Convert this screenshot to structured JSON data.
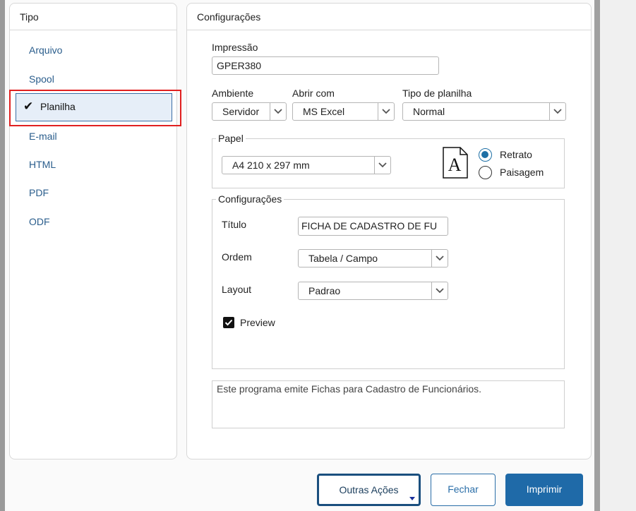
{
  "tipo": {
    "title": "Tipo",
    "items": [
      {
        "label": "Arquivo"
      },
      {
        "label": "Spool"
      },
      {
        "label": "Planilha",
        "selected": true
      },
      {
        "label": "E-mail"
      },
      {
        "label": "HTML"
      },
      {
        "label": "PDF"
      },
      {
        "label": "ODF"
      }
    ],
    "selected_check": "✔"
  },
  "config": {
    "title": "Configurações",
    "impressao": {
      "label": "Impressão",
      "value": "GPER380"
    },
    "ambiente": {
      "label": "Ambiente",
      "value": "Servidor"
    },
    "abrir_com": {
      "label": "Abrir com",
      "value": "MS Excel"
    },
    "tipo_planilha": {
      "label": "Tipo de planilha",
      "value": "Normal"
    },
    "papel": {
      "legend": "Papel",
      "size": "A4 210 x 297 mm",
      "orientation_icon_letter": "A",
      "retrato": "Retrato",
      "paisagem": "Paisagem",
      "selected": "Retrato"
    },
    "settings": {
      "legend": "Configurações",
      "titulo": {
        "label": "Título",
        "value": "FICHA DE CADASTRO DE FU"
      },
      "ordem": {
        "label": "Ordem",
        "value": "Tabela / Campo"
      },
      "layout": {
        "label": "Layout",
        "value": "Padrao"
      },
      "preview": {
        "label": "Preview",
        "checked": true
      }
    },
    "description": "Este programa emite Fichas para Cadastro de Funcionários."
  },
  "buttons": {
    "outras": "Outras Ações",
    "fechar": "Fechar",
    "imprimir": "Imprimir"
  },
  "colors": {
    "accent": "#1f6aa8",
    "highlight_border": "#e02020",
    "link": "#2a5d8c"
  }
}
